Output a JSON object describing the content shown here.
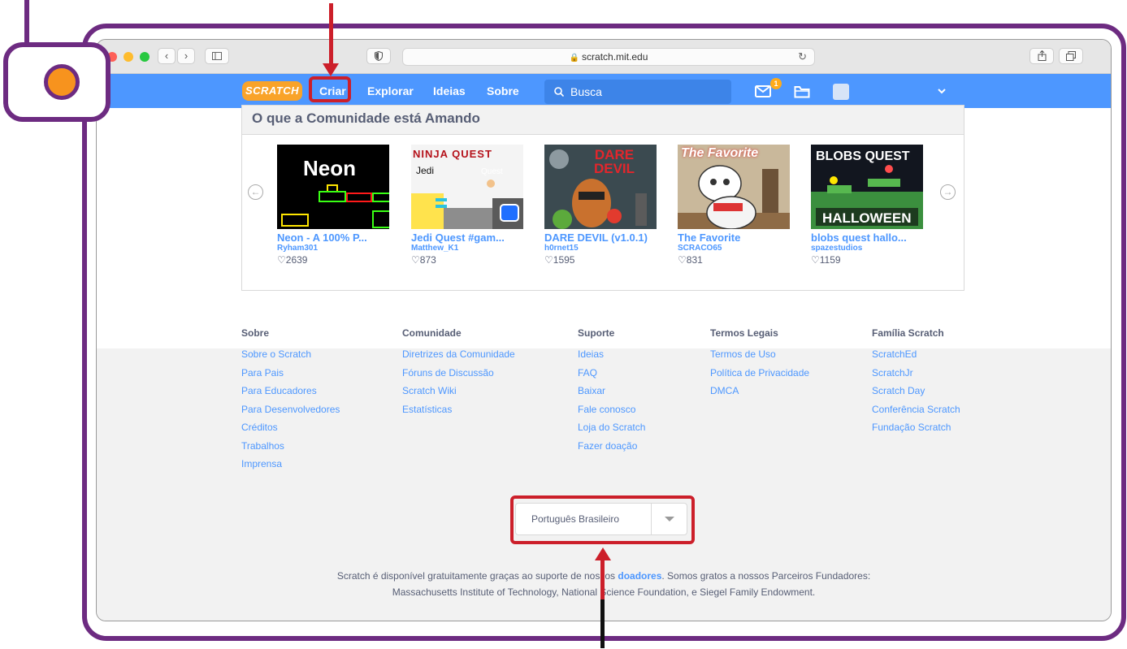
{
  "browser": {
    "url": "scratch.mit.edu",
    "back_label": "‹",
    "forward_label": "›"
  },
  "nav": {
    "logo": "SCRATCH",
    "links": [
      "Criar",
      "Explorar",
      "Ideias",
      "Sobre"
    ],
    "search_placeholder": "Busca",
    "mail_count": "1"
  },
  "community": {
    "heading": "O que a Comunidade está Amando",
    "projects": [
      {
        "title": "Neon - A 100% P...",
        "user": "Ryham301",
        "likes": "2639",
        "thumb_text": "Neon"
      },
      {
        "title": "Jedi Quest #gam...",
        "user": "Matthew_K1",
        "likes": "873",
        "thumb_text": "NINJA QUEST"
      },
      {
        "title": "DARE DEVIL (v1.0.1)",
        "user": "h0rnet15",
        "likes": "1595",
        "thumb_text": "DARE DEVIL"
      },
      {
        "title": "The Favorite",
        "user": "SCRACO65",
        "likes": "831",
        "thumb_text": "The Favorite"
      },
      {
        "title": "blobs quest hallo...",
        "user": "spazestudios",
        "likes": "1159",
        "thumb_text": "BLOBS QUEST"
      }
    ]
  },
  "footer": {
    "columns": [
      {
        "heading": "Sobre",
        "links": [
          "Sobre o Scratch",
          "Para Pais",
          "Para Educadores",
          "Para Desenvolvedores",
          "Créditos",
          "Trabalhos",
          "Imprensa"
        ]
      },
      {
        "heading": "Comunidade",
        "links": [
          "Diretrizes da Comunidade",
          "Fóruns de Discussão",
          "Scratch Wiki",
          "Estatísticas"
        ]
      },
      {
        "heading": "Suporte",
        "links": [
          "Ideias",
          "FAQ",
          "Baixar",
          "Fale conosco",
          "Loja do Scratch",
          "Fazer doação"
        ]
      },
      {
        "heading": "Termos Legais",
        "links": [
          "Termos de Uso",
          "Política de Privacidade",
          "DMCA"
        ]
      },
      {
        "heading": "Família Scratch",
        "links": [
          "ScratchEd",
          "ScratchJr",
          "Scratch Day",
          "Conferência Scratch",
          "Fundação Scratch"
        ]
      }
    ],
    "language": "Português Brasileiro",
    "credits_line1_pre": "Scratch é disponível gratuitamente graças ao suporte de nossos ",
    "credits_link": "doadores",
    "credits_line1_post": ". Somos gratos a nossos Parceiros Fundadores:",
    "credits_line2": "Massachusetts Institute of Technology, National Science Foundation, e Siegel Family Endowment."
  },
  "colors": {
    "scratch_blue": "#4d97ff",
    "frame_purple": "#6d2b81",
    "highlight_red": "#cc1f2a",
    "badge_orange": "#f7931e"
  }
}
